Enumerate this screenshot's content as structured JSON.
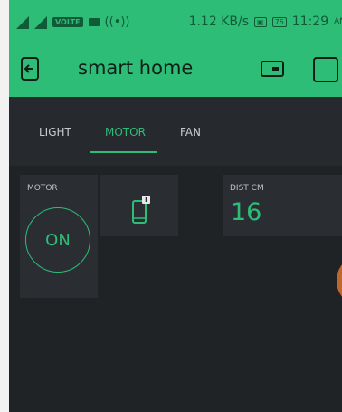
{
  "status_bar": {
    "network_speed": "1.12 KB/s",
    "volte_label": "VOLTE",
    "battery": "76",
    "time": "11:29",
    "time_suffix": "AN"
  },
  "app_bar": {
    "title": "smart home"
  },
  "tabs": [
    {
      "label": "LIGHT",
      "active": false
    },
    {
      "label": "MOTOR",
      "active": true
    },
    {
      "label": "FAN",
      "active": false
    }
  ],
  "widgets": {
    "motor_button": {
      "label": "MOTOR",
      "state": "ON"
    },
    "distance": {
      "label": "DIST CM",
      "value": "16"
    }
  },
  "colors": {
    "accent": "#2ebd77",
    "background": "#1f2326",
    "widget": "#2a2e33"
  }
}
